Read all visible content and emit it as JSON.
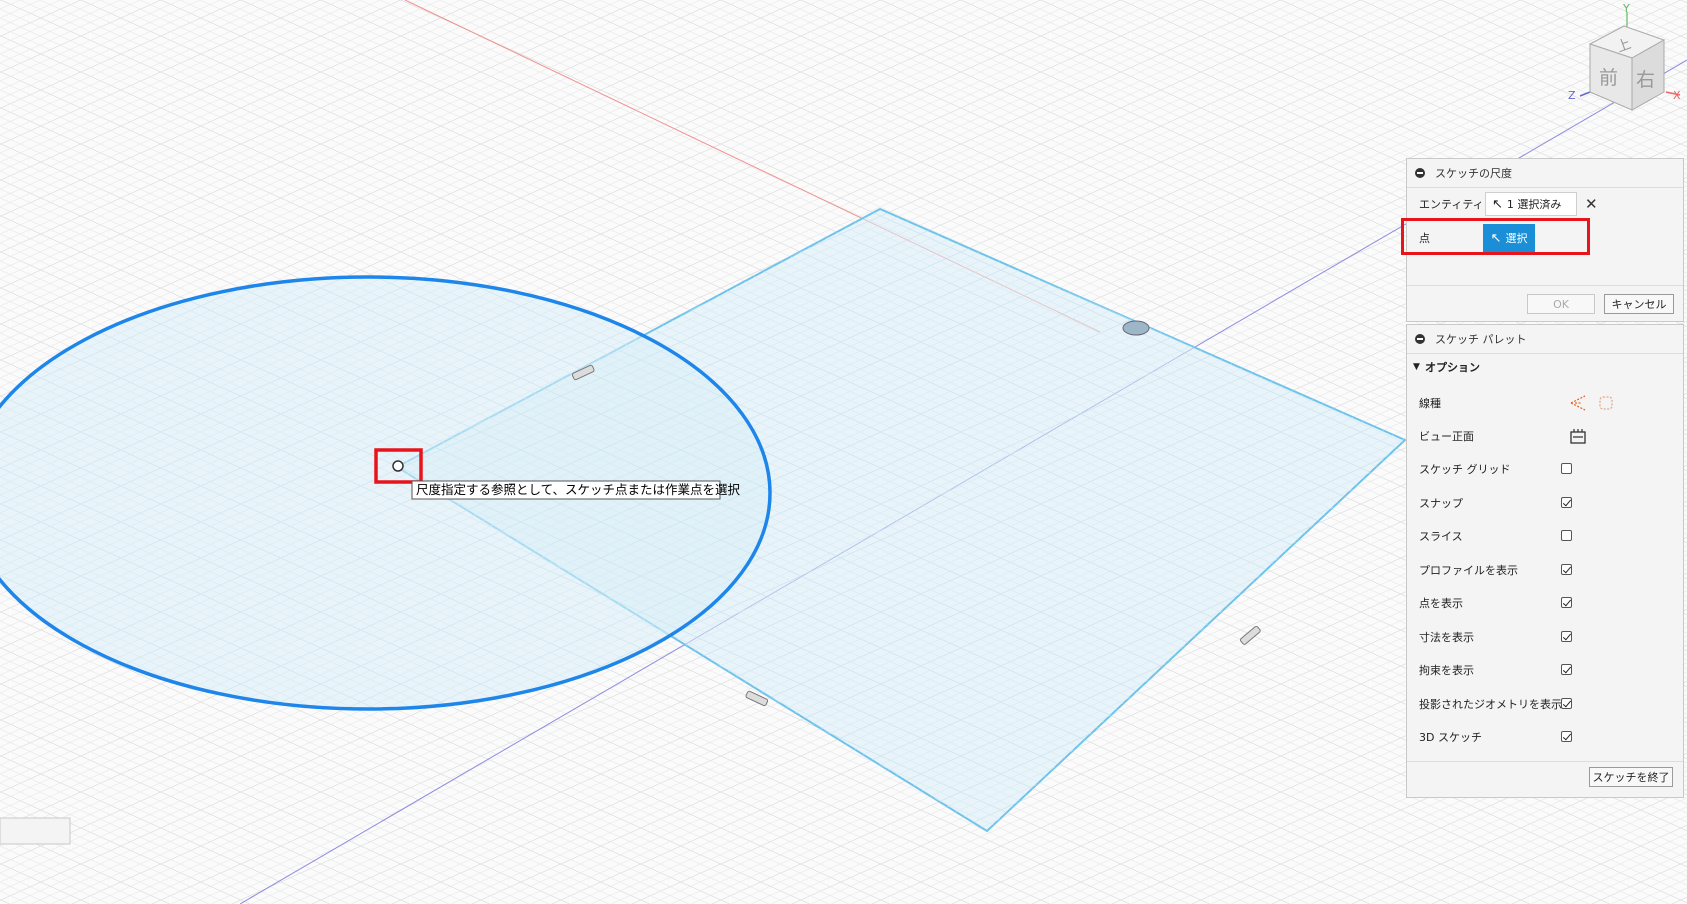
{
  "viewcube": {
    "face_top": "上",
    "face_front": "前",
    "face_right": "右",
    "axis_x": "X",
    "axis_y": "Y",
    "axis_z": "Z"
  },
  "tooltip": "尺度指定する参照として、スケッチ点または作業点を選択",
  "dimension_dialog": {
    "title": "スケッチの尺度",
    "entity_label": "エンティティ",
    "entity_selection": "1 選択済み",
    "point_label": "点",
    "select_label": "選択",
    "ok_label": "OK",
    "cancel_label": "キャンセル"
  },
  "palette": {
    "title": "スケッチ パレット",
    "options_header": "オプション",
    "linetype_label": "線種",
    "look_at_label": "ビュー正面",
    "options": [
      {
        "label": "スケッチ グリッド",
        "checked": false
      },
      {
        "label": "スナップ",
        "checked": true
      },
      {
        "label": "スライス",
        "checked": false
      },
      {
        "label": "プロファイルを表示",
        "checked": true
      },
      {
        "label": "点を表示",
        "checked": true
      },
      {
        "label": "寸法を表示",
        "checked": true
      },
      {
        "label": "拘束を表示",
        "checked": true
      },
      {
        "label": "投影されたジオメトリを表示",
        "checked": true
      },
      {
        "label": "3D スケッチ",
        "checked": true
      }
    ],
    "finish_label": "スケッチを終了"
  },
  "colors": {
    "highlight": "#e8141c",
    "accent": "#1a8fd8",
    "circle": "#1e86ea",
    "sketch_line": "#6fc3ea"
  }
}
